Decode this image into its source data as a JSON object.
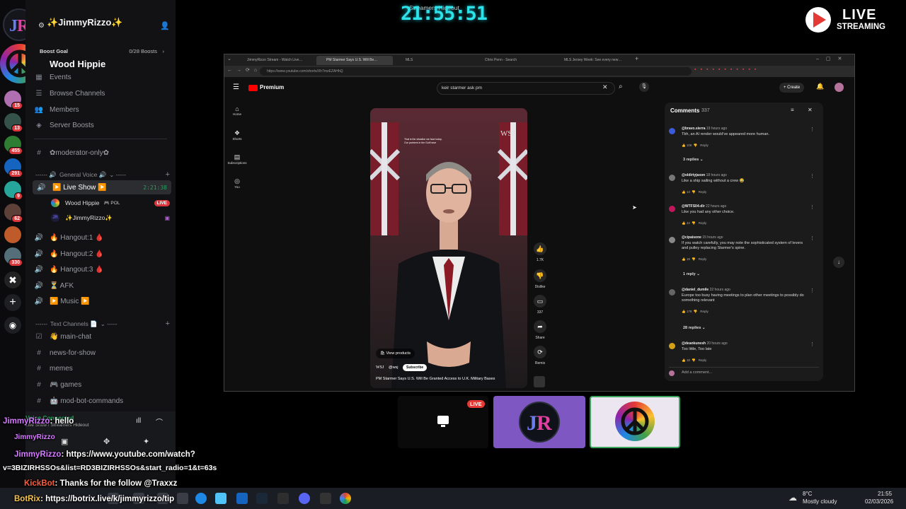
{
  "clock": {
    "time": "21:55:51",
    "subtitle": "Streamers Hideout"
  },
  "live_badge": {
    "line1": "LIVE",
    "line2": "STREAMING"
  },
  "discord": {
    "user_display": "✨JimmyRizzo✨",
    "server_name": "Wood Hippie",
    "boost_goal": {
      "label": "Boost Goal",
      "progress": "0/28 Boosts",
      "fraction": 0.0
    },
    "nav": [
      {
        "label": "Events",
        "icon": "calendar-icon"
      },
      {
        "label": "Browse Channels",
        "icon": "list-icon"
      },
      {
        "label": "Members",
        "icon": "members-icon"
      },
      {
        "label": "Server Boosts",
        "icon": "boost-icon"
      }
    ],
    "mod_channel": "✿moderator-only✿",
    "voice_category": "General Voice 🔊",
    "live_show": {
      "name": "▶️ Live Show ▶️",
      "timer": "2:21:38"
    },
    "live_members": [
      {
        "name": "Wood Hippie",
        "tag": "🎮 POL",
        "live": "LIVE"
      },
      {
        "name": "✨JimmyRizzo✨"
      }
    ],
    "voice_channels": [
      "🔥 Hangout:1 🩸",
      "🔥 Hangout:2 🩸",
      "🔥 Hangout:3 🩸",
      "⏳ AFK",
      "▶️ Music ▶️"
    ],
    "text_category": "Text Channels 📄",
    "text_channels": [
      "👋 main-chat",
      "news-for-show",
      "memes",
      "🎮 games",
      "🤖 mod-bot-commands"
    ],
    "voice_connected": {
      "status": "Voice Connected",
      "channel": "Live Show / Streamers Hideout"
    },
    "server_badges": [
      "15",
      "13",
      "455",
      "291",
      "9",
      "62",
      "330"
    ]
  },
  "browser": {
    "tabs": [
      "JimmyRizzo Stream - Watch Live…",
      "PM Starmer Says U.S. Will Be…",
      "MLS",
      "Chris Penn - Search",
      "MLS Jersey Week: See every new…"
    ],
    "url": "https://www.youtube.com/shorts/Xh7mzEZAHhQ",
    "youtube": {
      "brand": "Premium",
      "search_query": "keir starmer ask pm",
      "create_label": "Create",
      "left_nav": [
        "Home",
        "Shorts",
        "Subscriptions",
        "You"
      ],
      "short": {
        "caption": "That is the situation we face today. Our partners in the Gulf have",
        "watermark": "WSJ",
        "products": "View products",
        "channel": "@wsj",
        "subscribe": "Subscribe",
        "title": "PM Starmer Says U.S. Will Be Granted Access to U.K. Military Bases"
      },
      "actions": [
        {
          "label": "1.7K",
          "icon": "thumbs-up-icon"
        },
        {
          "label": "Dislike",
          "icon": "thumbs-down-icon"
        },
        {
          "label": "337",
          "icon": "comment-icon"
        },
        {
          "label": "Share",
          "icon": "share-icon"
        },
        {
          "label": "Remix",
          "icon": "remix-icon"
        }
      ],
      "comments": {
        "title": "Comments",
        "count": "337",
        "add_placeholder": "Add a comment...",
        "reply_label": "Reply",
        "items": [
          {
            "author": "@bravo.sierra",
            "time": "19 hours ago",
            "text": "Tbh, an AI render would've appeared more human.",
            "likes": "106",
            "replies": "3 replies",
            "color": "#3b5bdb"
          },
          {
            "author": "@oldirtyjaxon",
            "time": "18 hours ago",
            "text": "Like a ship sailing without a crew 😂",
            "likes": "13",
            "replies": "",
            "color": "#777777"
          },
          {
            "author": "@WTFS04-dlr",
            "time": "22 hours ago",
            "text": "Like you had any other choice.",
            "likes": "42",
            "replies": "",
            "color": "#c2185b"
          },
          {
            "author": "@cipaisone",
            "time": "15 hours ago",
            "text": "If you watch carefully, you may note the sophisticated system of levers and pulley replacing Starmer's spine.",
            "likes": "19",
            "replies": "1 reply",
            "color": "#888888"
          },
          {
            "author": "@daniel_dumile",
            "time": "22 hours ago",
            "text": "Europe too busy having meetings to plan other meetings to possibly do something relevant",
            "likes": "178",
            "replies": "28 replies",
            "color": "#666666"
          },
          {
            "author": "@deankunesh",
            "time": "20 hours ago",
            "text": "Too little, Too late",
            "likes": "18",
            "replies": "",
            "color": "#d4a017"
          }
        ]
      }
    }
  },
  "tiles": {
    "live_label": "LIVE"
  },
  "chat": [
    {
      "nick": "JimmyRizzo",
      "msg": ": hello"
    },
    {
      "nick": "JimmyRizzo",
      "msg": ": https://www.youtube.com/watch?"
    },
    {
      "nick": "",
      "msg": "v=3BIZIRHSSOs&list=RD3BIZIRHSSOs&start_radio=1&t=63s"
    },
    {
      "nick": "KickBot",
      "msg": ": Thanks for the follow @Traxxz"
    },
    {
      "nick": "BotRix",
      "msg": ": https://botrix.live/k/jimmyrizzo/tip"
    }
  ],
  "taskbar": {
    "temp": "8°C",
    "weather": "Mostly cloudy",
    "time": "21:55",
    "date": "02/03/2026"
  },
  "colors": {
    "accent_cyan": "#2de2e8",
    "live_red": "#e53935",
    "discord_bg": "#121214",
    "yt_red": "#ff0000"
  }
}
